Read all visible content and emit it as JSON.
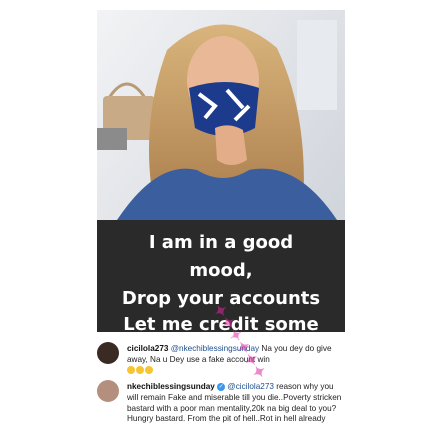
{
  "story": {
    "caption_lines": [
      "I am in a good",
      "mood,",
      "Drop your accounts",
      "Let me credit some"
    ]
  },
  "comments": [
    {
      "username": "cicilola273",
      "mention": "@nkechiblessingsunday",
      "text": "Na you dey do give away, Na u Dey use a fake account win",
      "emoji_count": 3
    },
    {
      "username": "nkechiblessingsunday",
      "mention": "@cicilola273",
      "text": "reason why you will remain Fake and miserable till you die..Poverty stricken bastard with a poor man mentality,20k na big deal to you? Hungry bastard. From the pit of hell..Rot in hell already"
    }
  ],
  "colors": {
    "caption_bg": "#2a2a2a",
    "verified": "#3897f0",
    "watermark": "#dc28a0"
  }
}
